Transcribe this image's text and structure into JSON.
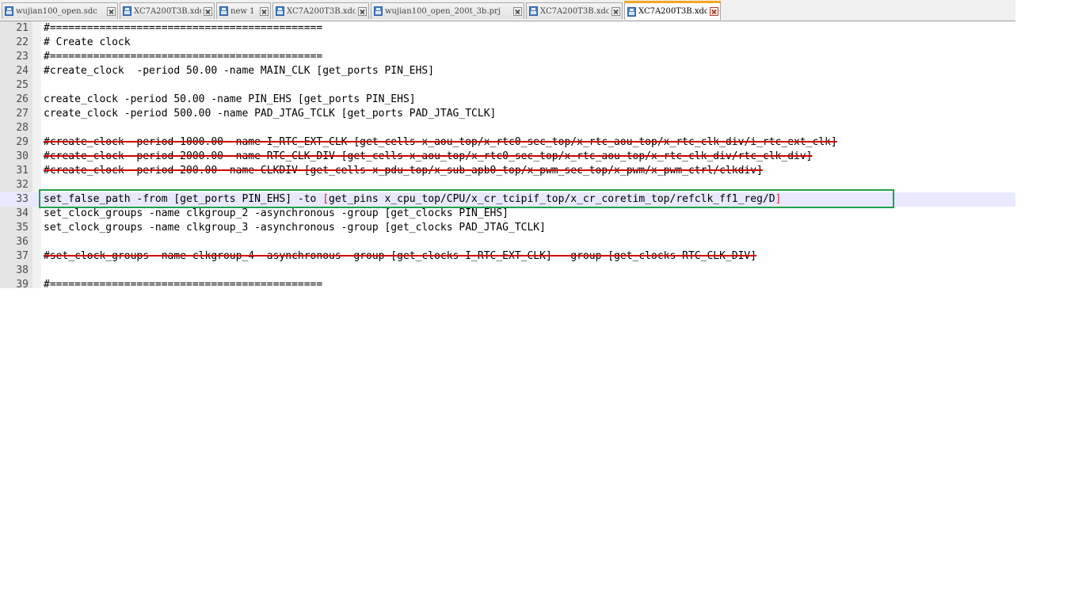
{
  "tabs": [
    {
      "label": "wujian100_open.sdc",
      "active": false
    },
    {
      "label": "XC7A200T3B.xdc",
      "active": false
    },
    {
      "label": "new 1",
      "active": false
    },
    {
      "label": "XC7A200T3B.xdc",
      "active": false
    },
    {
      "label": "wujian100_open_200t_3b.prj",
      "active": false
    },
    {
      "label": "XC7A200T3B.xdc",
      "active": false
    },
    {
      "label": "XC7A200T3B.xdc",
      "active": true
    }
  ],
  "editor": {
    "current_line": "33",
    "highlight_color": "#1fa34a",
    "lines": [
      {
        "num": "21",
        "text": "#============================================"
      },
      {
        "num": "22",
        "text": "# Create clock"
      },
      {
        "num": "23",
        "text": "#============================================"
      },
      {
        "num": "24",
        "text": "#create_clock  -period 50.00 -name MAIN_CLK [get_ports PIN_EHS]"
      },
      {
        "num": "25",
        "text": ""
      },
      {
        "num": "26",
        "text": "create_clock -period 50.00 -name PIN_EHS [get_ports PIN_EHS]"
      },
      {
        "num": "27",
        "text": "create_clock -period 500.00 -name PAD_JTAG_TCLK [get_ports PAD_JTAG_TCLK]"
      },
      {
        "num": "28",
        "text": ""
      },
      {
        "num": "29",
        "text": "#create_clock -period 1000.00 -name I_RTC_EXT_CLK [get_cells x_aou_top/x_rtc0_sec_top/x_rtc_aou_top/x_rtc_clk_div/i_rtc_ext_clk]"
      },
      {
        "num": "30",
        "text": "#create_clock -period 2000.00 -name RTC_CLK_DIV [get_cells x_aou_top/x_rtc0_sec_top/x_rtc_aou_top/x_rtc_clk_div/rtc_clk_div]"
      },
      {
        "num": "31",
        "text": "#create_clock -period 200.00 -name CLKDIV [get_cells x_pdu_top/x_sub_apb0_top/x_pwm_sec_top/x_pwm/x_pwm_ctrl/clkdiv]"
      },
      {
        "num": "32",
        "text": ""
      },
      {
        "num": "33",
        "text_a": "set_false_path -from [get_ports PIN_EHS] -to ",
        "text_bracket_open": "[",
        "text_b": "get_pins x_cpu_top/CPU/x_cr_tcipif_top/x_cr_coretim_top/refclk_ff1_reg/D",
        "text_bracket_close": "]"
      },
      {
        "num": "34",
        "text": "set_clock_groups -name clkgroup_2 -asynchronous -group [get_clocks PIN_EHS]"
      },
      {
        "num": "35",
        "text": "set_clock_groups -name clkgroup_3 -asynchronous -group [get_clocks PAD_JTAG_TCLK]"
      },
      {
        "num": "36",
        "text": ""
      },
      {
        "num": "37",
        "text": "#set_clock_groups -name clkgroup_4 -asynchronous -group [get_clocks I_RTC_EXT_CLK]  -group [get_clocks RTC_CLK_DIV]"
      },
      {
        "num": "38",
        "text": ""
      },
      {
        "num": "39",
        "text": "#============================================"
      }
    ]
  }
}
